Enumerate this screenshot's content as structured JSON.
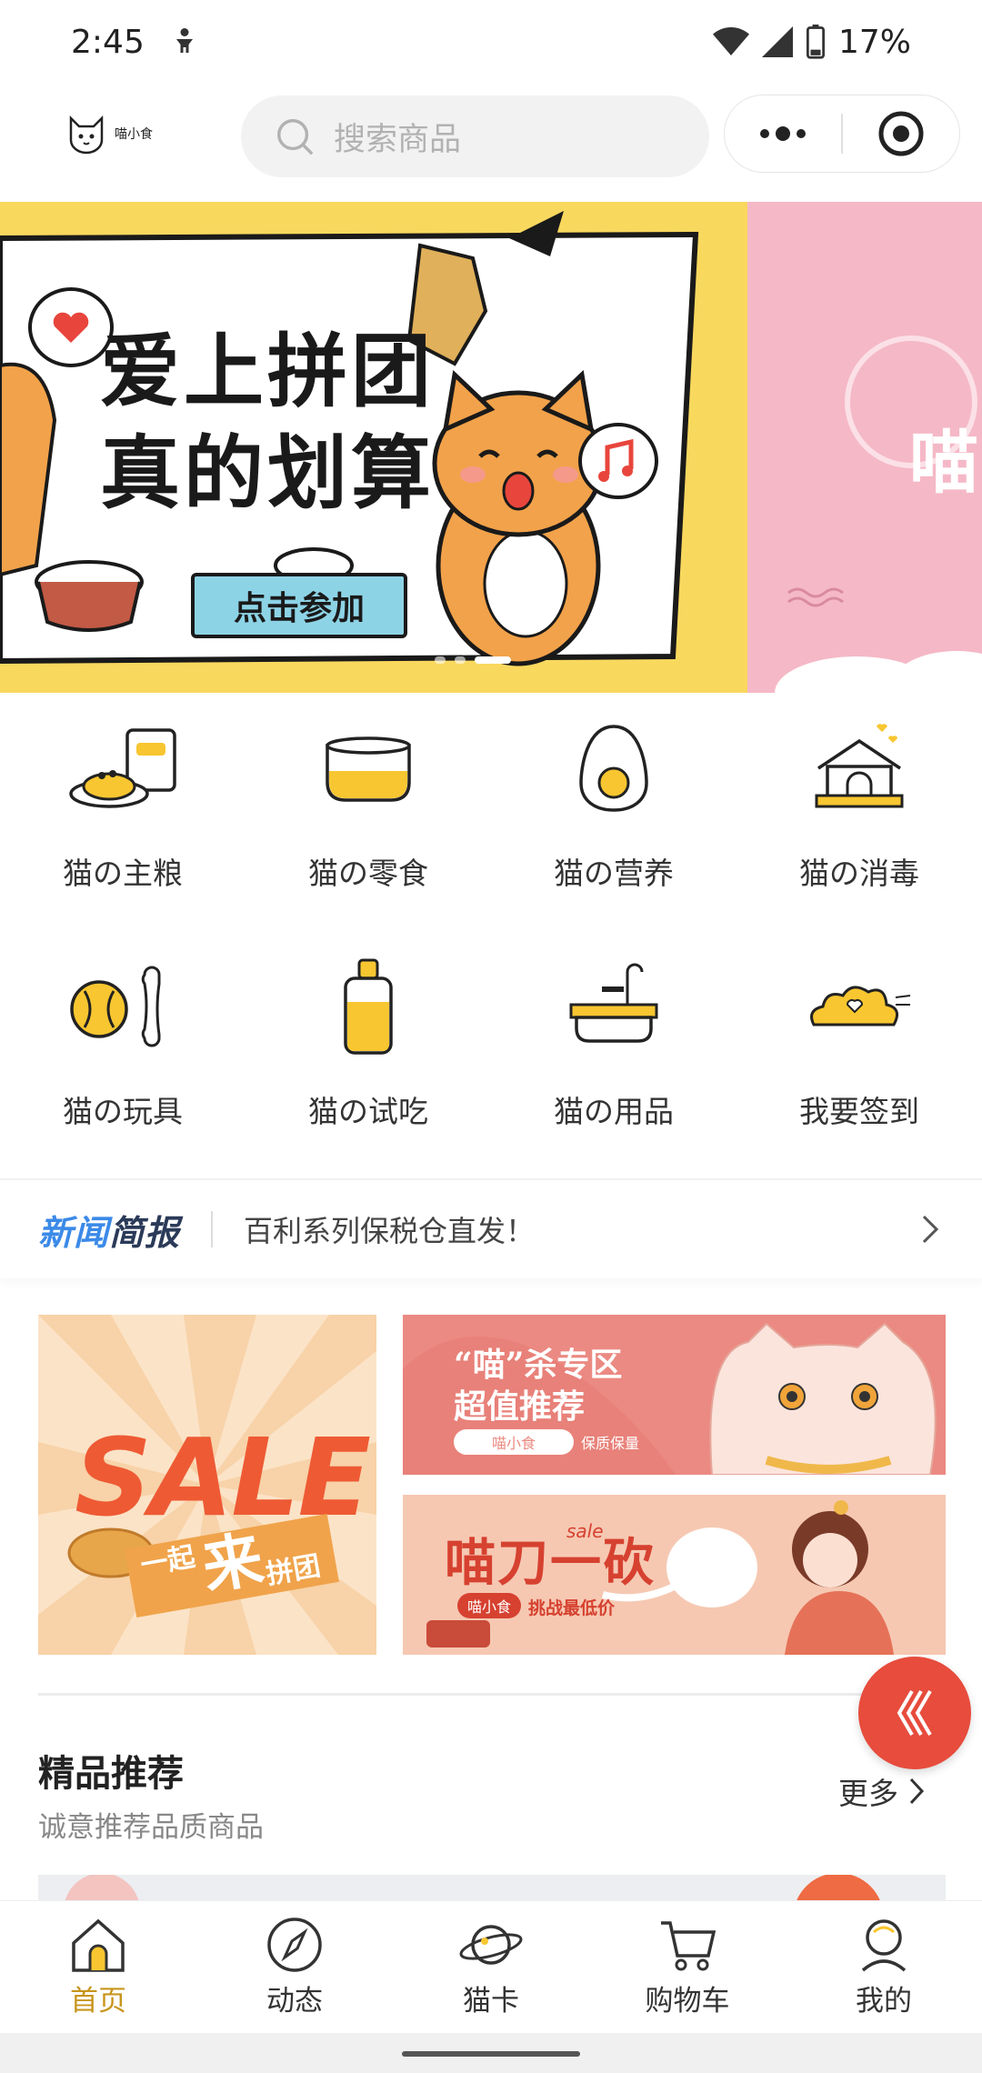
{
  "status_bar": {
    "time": "2:45",
    "battery": "17%"
  },
  "header": {
    "logo_text": "喵小食",
    "search_placeholder": "搜索商品"
  },
  "banner": {
    "slide1_title_line1": "爱上拼团",
    "slide1_title_line2": "真的划算",
    "slide1_cta": "点击参加",
    "slide2_text": "喵"
  },
  "categories": [
    {
      "label": "猫の主粮",
      "icon": "cat-food-bowl-icon"
    },
    {
      "label": "猫の零食",
      "icon": "snack-bowl-icon"
    },
    {
      "label": "猫の营养",
      "icon": "egg-icon"
    },
    {
      "label": "猫の消毒",
      "icon": "cat-house-icon"
    },
    {
      "label": "猫の玩具",
      "icon": "ball-bone-icon"
    },
    {
      "label": "猫の试吃",
      "icon": "bottle-icon"
    },
    {
      "label": "猫の用品",
      "icon": "bathtub-icon"
    },
    {
      "label": "我要签到",
      "icon": "cloud-heart-icon"
    }
  ],
  "news": {
    "logo_part1": "新闻",
    "logo_part2": "简报",
    "text": "百利系列保税仓直发！"
  },
  "promos": {
    "sale": {
      "big": "SALE",
      "sub_left": "一起",
      "sub_big": "来",
      "sub_right": "拼团"
    },
    "zone": {
      "title_line1": "“喵”杀专区",
      "title_line2": "超值推荐",
      "pill": "喵小食",
      "tag": "保质保量"
    },
    "bargain": {
      "title": "喵刀一砍",
      "sale": "sale",
      "pill": "喵小食",
      "tag": "挑战最低价"
    }
  },
  "section": {
    "title": "精品推荐",
    "subtitle": "诚意推荐品质商品",
    "more": "更多"
  },
  "tabs": [
    {
      "label": "首页",
      "active": true,
      "icon": "home-icon"
    },
    {
      "label": "动态",
      "active": false,
      "icon": "compass-icon"
    },
    {
      "label": "猫卡",
      "active": false,
      "icon": "planet-icon"
    },
    {
      "label": "购物车",
      "active": false,
      "icon": "cart-icon"
    },
    {
      "label": "我的",
      "active": false,
      "icon": "profile-icon"
    }
  ],
  "colors": {
    "accent": "#c8951c",
    "banner_yellow": "#f9d85e",
    "fab_red": "#e74c3c",
    "icon_yellow": "#f8c630"
  }
}
